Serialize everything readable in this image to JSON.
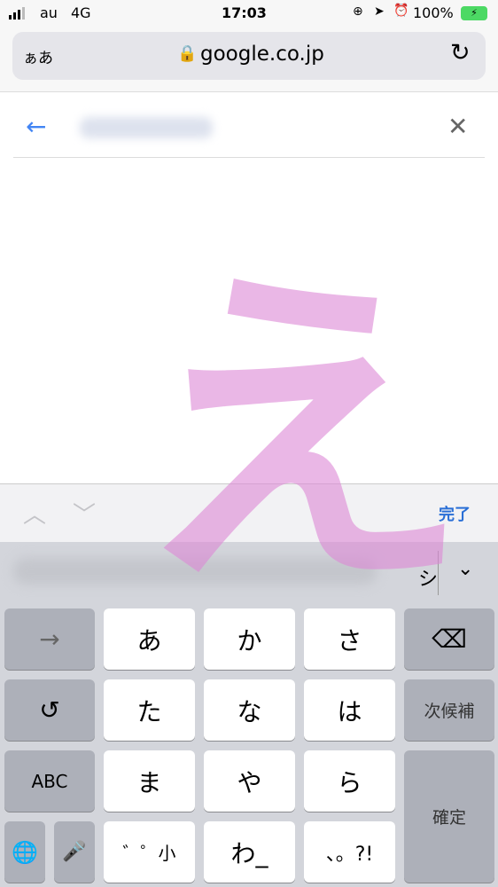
{
  "status": {
    "carrier": "au",
    "network": "4G",
    "time": "17:03",
    "battery": "100%",
    "icons": [
      "signal-icon",
      "orientation-lock-icon",
      "location-icon",
      "alarm-icon",
      "battery-charging-icon"
    ]
  },
  "browser": {
    "text_size": "ぁあ",
    "url": "google.co.jp",
    "icons": [
      "lock-icon",
      "reload-icon"
    ]
  },
  "search": {
    "icons": [
      "back-arrow-icon",
      "close-icon"
    ]
  },
  "toolbar": {
    "done": "完了",
    "accent": "#2a6fd6"
  },
  "candidates": {
    "visible": "シ"
  },
  "keyboard": {
    "rows": [
      [
        "→",
        "あ",
        "か",
        "さ",
        "⌫"
      ],
      [
        "↺",
        "た",
        "な",
        "は",
        "次候補"
      ],
      [
        "ABC",
        "ま",
        "や",
        "ら",
        "確定"
      ],
      [
        "🌐",
        "🎤",
        "゛゜小",
        "わ_",
        "、。?!"
      ]
    ]
  },
  "overlay": {
    "char": "え",
    "color": "#dd88d6"
  }
}
